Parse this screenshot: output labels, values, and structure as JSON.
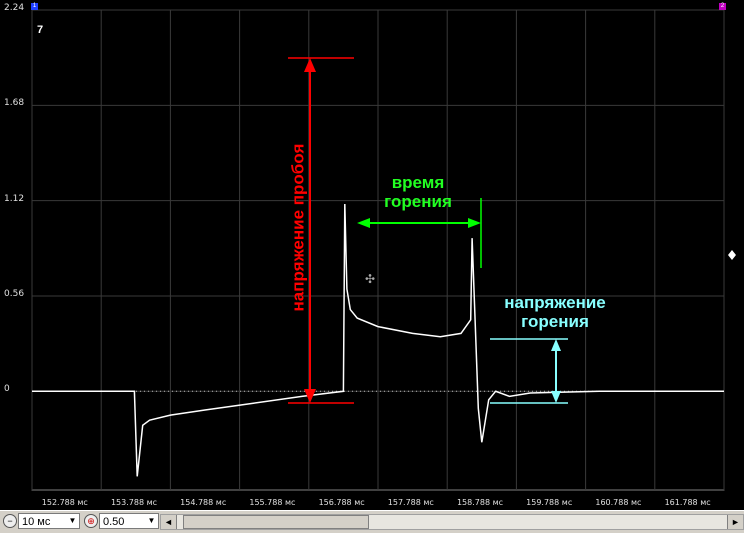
{
  "chart_data": {
    "type": "line",
    "title": "",
    "channel_number": "7",
    "xlabel": "",
    "ylabel": "",
    "y_ticks": [
      "2.24",
      "1.68",
      "1.12",
      "0.56",
      "0"
    ],
    "x_ticks": [
      "152.788 мс",
      "153.788 мс",
      "154.788 мс",
      "155.788 мс",
      "156.788 мс",
      "157.788 мс",
      "158.788 мс",
      "159.788 мс",
      "160.788 мс",
      "161.788 мс"
    ],
    "xlim_ms": [
      152.3,
      162.3
    ],
    "ylim": [
      -0.58,
      2.24
    ],
    "series": [
      {
        "color": "#ffffff",
        "x": [
          152.3,
          153.7,
          153.78,
          153.82,
          153.9,
          154.0,
          154.3,
          154.8,
          155.5,
          156.2,
          156.8,
          156.82,
          156.85,
          156.9,
          157.0,
          157.3,
          157.8,
          158.2,
          158.5,
          158.64,
          158.66,
          158.7,
          158.75,
          158.8,
          158.9,
          159.0,
          159.2,
          159.5,
          160.5,
          162.3
        ],
        "y": [
          0.0,
          0.0,
          0.0,
          -0.5,
          -0.2,
          -0.17,
          -0.14,
          -0.11,
          -0.07,
          -0.03,
          0.0,
          1.1,
          0.6,
          0.48,
          0.43,
          0.38,
          0.34,
          0.32,
          0.34,
          0.42,
          0.9,
          0.45,
          -0.1,
          -0.3,
          -0.05,
          0.0,
          -0.03,
          -0.01,
          0.0,
          0.0
        ]
      }
    ],
    "annotations": [
      {
        "text": "напряжение пробоя",
        "color": "#ff0000"
      },
      {
        "text": "время\nгорения",
        "color": "#00ff00"
      },
      {
        "text": "напряжение\nгорения",
        "color": "#88ffff"
      }
    ],
    "grid": true
  },
  "toolbar": {
    "timebase_value": "10 мс",
    "gain_value": "0.50",
    "scroll_left": "◄",
    "scroll_right": "►"
  },
  "markers": {
    "left": "1",
    "right": "2"
  }
}
